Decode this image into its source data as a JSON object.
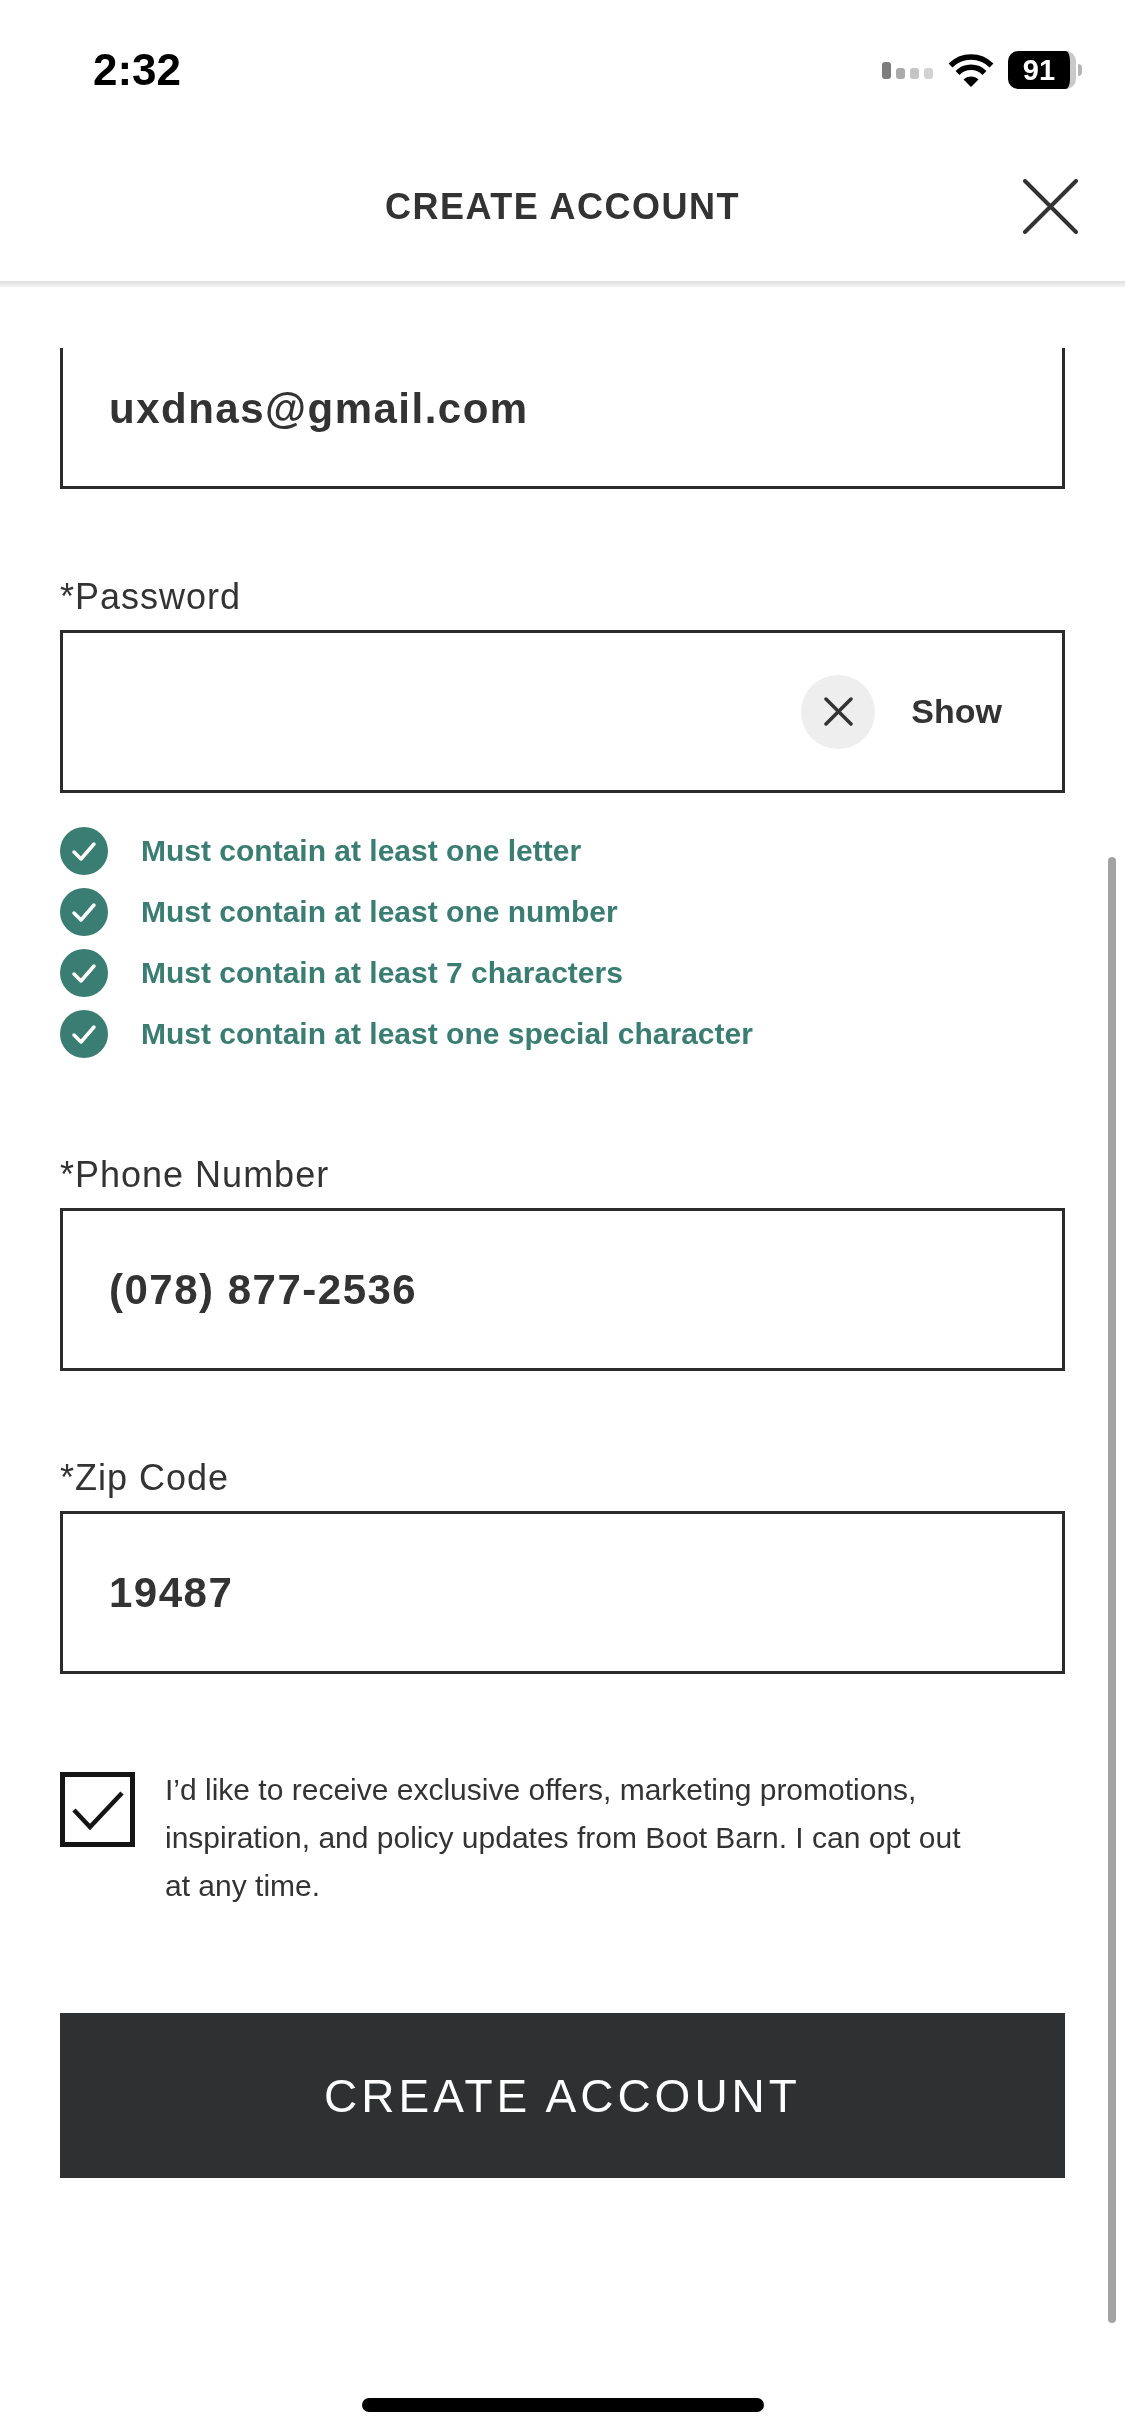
{
  "status_bar": {
    "time": "2:32",
    "battery": "91"
  },
  "header": {
    "title": "CREATE ACCOUNT"
  },
  "email_field": {
    "value": "uxdnas@gmail.com"
  },
  "password": {
    "label": "*Password",
    "show_button": "Show",
    "requirements": [
      {
        "text": "Must contain at least one letter",
        "met": true
      },
      {
        "text": "Must contain at least one number",
        "met": true
      },
      {
        "text": "Must contain at least 7 characters",
        "met": true
      },
      {
        "text": "Must contain at least one special character",
        "met": true
      }
    ]
  },
  "phone": {
    "label": "*Phone Number",
    "value": "(078) 877-2536"
  },
  "zip_code": {
    "label": "*Zip Code",
    "value": "19487"
  },
  "consent": {
    "checked": true,
    "text": "I’d like to receive exclusive offers, marketing promotions, inspiration, and policy updates from Boot Barn. I can opt out at any time."
  },
  "submit_button": {
    "label": "CREATE ACCOUNT"
  }
}
